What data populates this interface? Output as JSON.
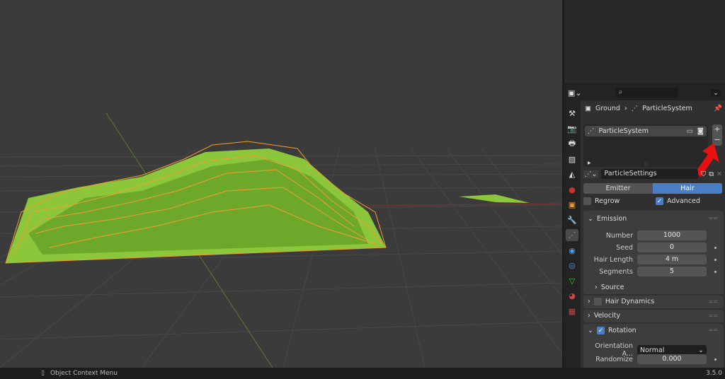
{
  "colors": {
    "accent": "#4a7fc6",
    "wireframe": "#f0a030",
    "grass": "#8cc63a",
    "arrow": "#e81010"
  },
  "properties": {
    "breadcrumb": {
      "object": "Ground",
      "item": "ParticleSystem"
    },
    "particle_list": {
      "items": [
        "ParticleSystem"
      ]
    },
    "settings_name": "ParticleSettings",
    "type_tabs": [
      "Emitter",
      "Hair"
    ],
    "selected_type": "Hair",
    "regrow": {
      "label": "Regrow",
      "checked": false
    },
    "advanced": {
      "label": "Advanced",
      "checked": true
    },
    "emission": {
      "title": "Emission",
      "fields": [
        {
          "label": "Number",
          "value": "1000"
        },
        {
          "label": "Seed",
          "value": "0"
        },
        {
          "label": "Hair Length",
          "value": "4 m"
        },
        {
          "label": "Segments",
          "value": "5"
        }
      ],
      "source": "Source"
    },
    "hair_dynamics": {
      "title": "Hair Dynamics",
      "checked": false
    },
    "velocity": {
      "title": "Velocity"
    },
    "rotation": {
      "title": "Rotation",
      "checked": true,
      "orientation_label": "Orientation A...",
      "orientation_value": "Normal",
      "randomize_label": "Randomize",
      "randomize_value": "0.000"
    }
  },
  "status": {
    "context_menu": "Object Context Menu",
    "version": "3.5.0"
  }
}
